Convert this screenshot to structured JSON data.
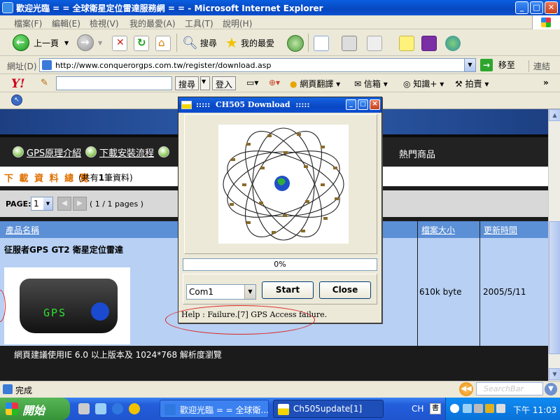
{
  "window": {
    "title": "歡迎光臨 = = 全球衛星定位雷達服務網 = = - Microsoft Internet Explorer",
    "min": "_",
    "max": "□",
    "close": "✕"
  },
  "menu": [
    "檔案(F)",
    "編輯(E)",
    "檢視(V)",
    "我的最愛(A)",
    "工具(T)",
    "說明(H)"
  ],
  "toolbar": {
    "back_label": "上一頁",
    "search_label": "搜尋",
    "favorites_label": "我的最愛"
  },
  "address": {
    "label": "網址(D)",
    "url": "http://www.conquerorgps.com.tw/register/download.asp",
    "go_label": "移至",
    "links_label": "連結"
  },
  "yahoo_bar": {
    "logo": "Y!",
    "search_btn": "搜尋",
    "login_btn": "登入",
    "translate": "網頁翻譯",
    "mail": "信箱",
    "knowledge": "知識+",
    "auction": "拍賣"
  },
  "site": {
    "nav": [
      "GPS原理介紹",
      "下載安裝流程"
    ],
    "hot": "熱門商品",
    "summary_title": "下 載 資 料 總 覽",
    "summary_count_prefix": "(共有",
    "summary_count": "1",
    "summary_count_suffix": "筆資料)",
    "page_label": "PAGE:",
    "page_value": "1",
    "page_info": "( 1 / 1 pages )",
    "headers": {
      "name": "產品名稱",
      "size": "檔案大小",
      "date": "更新時間"
    },
    "row": {
      "name": "征服者GPS GT2 衛星定位雷達",
      "size": "610k byte",
      "date": "2005/5/11",
      "device_text": "GPS"
    },
    "footer": "網頁建議使用IE 6.0 以上版本及 1024*768 解析度瀏覽"
  },
  "dialog": {
    "title": ":::::  CH505 Download  :::::",
    "progress": "0%",
    "port": "Com1",
    "start": "Start",
    "close": "Close",
    "status_prefix": "Help :",
    "status": "Failure.[7] GPS Access failure."
  },
  "statusbar": {
    "text": "完成",
    "search_placeholder": "SearchBar"
  },
  "taskbar": {
    "start": "開始",
    "tasks": [
      "歡迎光臨 = = 全球衛...",
      "Ch505update[1]"
    ],
    "lang": "CH",
    "clock": "下午 11:03"
  },
  "colors": {
    "xp_blue": "#0A4FD0",
    "table_header": "#5b8fd6",
    "table_row": "#b7d0f3",
    "summary_orange": "#e07000",
    "annotation_red": "#dd2222"
  }
}
